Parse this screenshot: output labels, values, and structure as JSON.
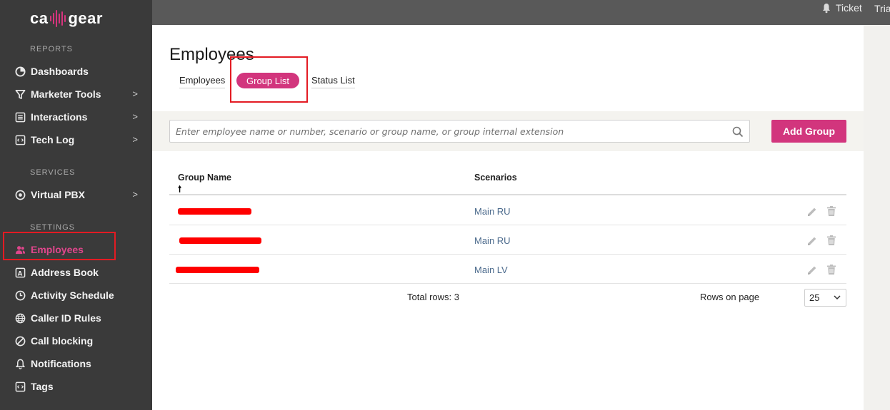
{
  "brand": {
    "logo_left": "ca",
    "logo_right": "gear",
    "accent": "#d2357d"
  },
  "sidebar": {
    "sections": {
      "reports": "REPORTS",
      "services": "SERVICES",
      "settings": "SETTINGS"
    },
    "items": [
      {
        "label": "Dashboards",
        "icon": "pie-chart-icon",
        "chevron": ""
      },
      {
        "label": "Marketer Tools",
        "icon": "filter-icon",
        "chevron": ">"
      },
      {
        "label": "Interactions",
        "icon": "list-icon",
        "chevron": ">"
      },
      {
        "label": "Tech Log",
        "icon": "code-file-icon",
        "chevron": ">"
      },
      {
        "label": "Virtual PBX",
        "icon": "pbx-icon",
        "chevron": ">"
      },
      {
        "label": "Employees",
        "icon": "users-icon",
        "chevron": ""
      },
      {
        "label": "Address Book",
        "icon": "address-book-icon",
        "chevron": ""
      },
      {
        "label": "Activity Schedule",
        "icon": "clock-icon",
        "chevron": ""
      },
      {
        "label": "Caller ID Rules",
        "icon": "globe-icon",
        "chevron": ""
      },
      {
        "label": "Call blocking",
        "icon": "block-icon",
        "chevron": ""
      },
      {
        "label": "Notifications",
        "icon": "bell-icon",
        "chevron": ""
      },
      {
        "label": "Tags",
        "icon": "tag-file-icon",
        "chevron": ""
      }
    ]
  },
  "topbar": {
    "ticket_label": "Ticket",
    "trial_label": "Tria"
  },
  "page": {
    "title": "Employees",
    "tabs": [
      {
        "label": "Employees"
      },
      {
        "label": "Group List"
      },
      {
        "label": "Status List"
      }
    ]
  },
  "search": {
    "placeholder": "Enter employee name or number, scenario or group name, or group internal extension"
  },
  "add_group_label": "Add Group",
  "table": {
    "columns": {
      "group_name": "Group Name",
      "scenarios": "Scenarios"
    },
    "sort_arrow": "🠕",
    "rows": [
      {
        "scenario": "Main RU"
      },
      {
        "scenario": "Main RU"
      },
      {
        "scenario": "Main LV"
      }
    ]
  },
  "footer": {
    "total_rows": "Total rows: 3",
    "rows_on_page_label": "Rows on page",
    "rows_on_page_value": "25"
  }
}
